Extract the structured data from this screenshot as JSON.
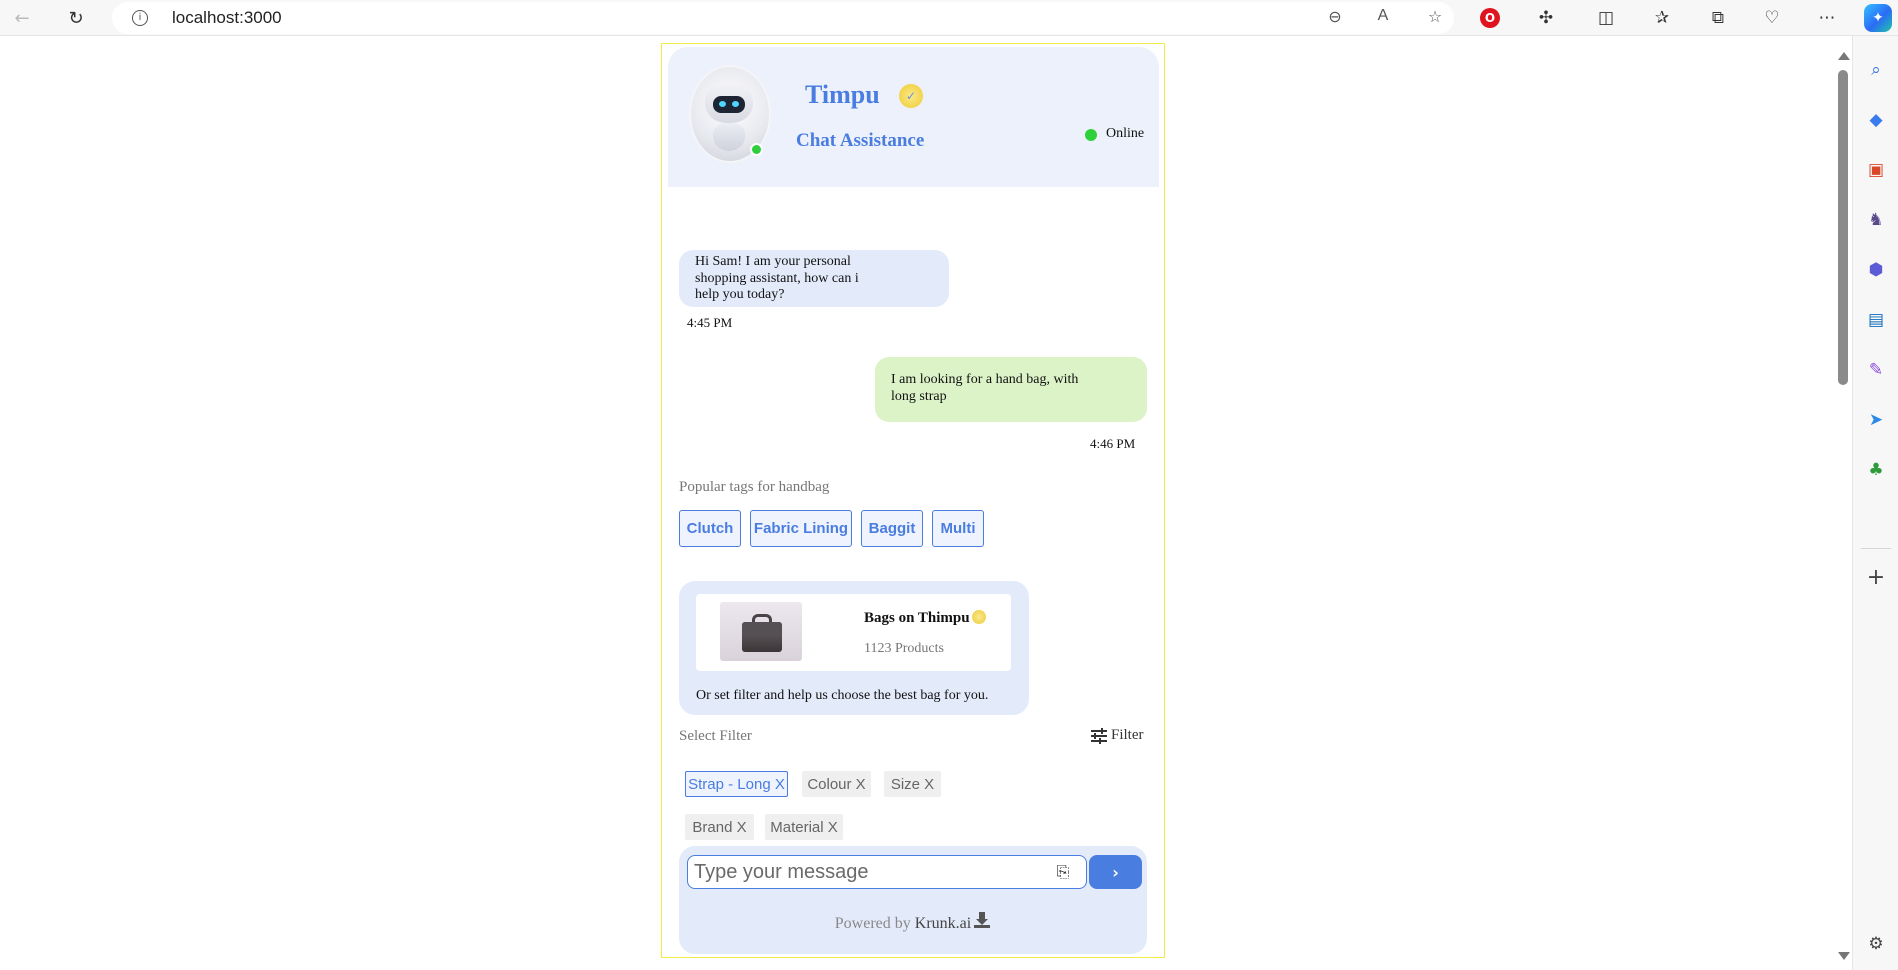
{
  "browser": {
    "url": "localhost:3000"
  },
  "chat": {
    "bot_name": "Timpu",
    "subtitle": "Chat Assistance",
    "status": "Online",
    "messages": [
      {
        "from": "bot",
        "text": "Hi Sam! I am your personal shopping assistant, how can i help you today?",
        "time": "4:45 PM"
      },
      {
        "from": "user",
        "text": "I am looking for a hand bag, with long strap",
        "time": "4:46 PM"
      }
    ],
    "tags_label": "Popular tags for handbag",
    "tags": [
      "Clutch",
      "Fabric Lining",
      "Baggit",
      "Multi"
    ],
    "card": {
      "title": "Bags on Thimpu",
      "count": "1123 Products",
      "text": "Or set filter and help us choose the best bag for you."
    },
    "filter_label": "Select Filter",
    "filter_button": "Filter",
    "filters": [
      {
        "label": "Strap - Long X",
        "active": true
      },
      {
        "label": "Colour X",
        "active": false
      },
      {
        "label": "Size X",
        "active": false
      },
      {
        "label": "Brand X",
        "active": false
      },
      {
        "label": "Material X",
        "active": false
      }
    ],
    "input_placeholder": "Type your message",
    "powered_prefix": "Powered by",
    "powered_brand": "Krunk.ai"
  },
  "colors": {
    "accent": "#4a7de0",
    "bot_bubble": "#e3ebfb",
    "user_bubble": "#dcf2c7",
    "online": "#2fd13b",
    "widget_border": "#f2ec4a"
  },
  "icons": {
    "back": "arrow-left-icon",
    "refresh": "refresh-icon",
    "info": "info-icon",
    "zoom_out": "zoom-out-icon",
    "read_aloud": "read-aloud-icon",
    "favorite": "star-icon",
    "attach": "paperclip-icon",
    "send": "chevron-right-icon",
    "filter": "sliders-icon"
  }
}
